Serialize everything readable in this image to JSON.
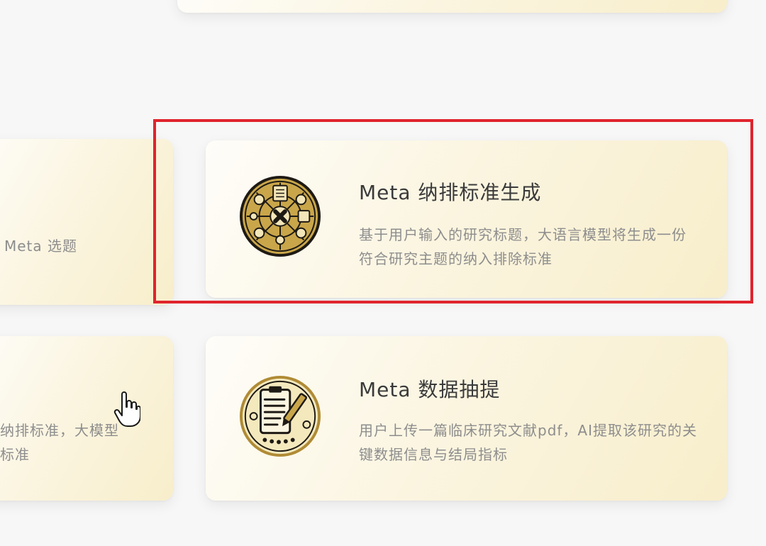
{
  "cards": {
    "left_1": {
      "text": "Meta 选题"
    },
    "left_2": {
      "line1": "纳排标准，大模型",
      "line2": "标准"
    },
    "criteria": {
      "title": "Meta 纳排标准生成",
      "description": "基于用户输入的研究标题，大语言模型将生成一份符合研究主题的纳入排除标准",
      "icon": "criteria-medal-icon"
    },
    "extract": {
      "title": "Meta 数据抽提",
      "description": "用户上传一篇临床研究文献pdf，AI提取该研究的关键数据信息与结局指标",
      "icon": "data-extract-medal-icon"
    }
  },
  "highlight": {
    "color": "#e0242d"
  },
  "colors": {
    "background": "#f7f7f7",
    "title": "#3a3a3a",
    "description": "#8d8d8d",
    "medal_gold": "#c9a64a",
    "medal_dark": "#1e1a14"
  },
  "cursor": {
    "icon": "hand-pointer-icon"
  }
}
